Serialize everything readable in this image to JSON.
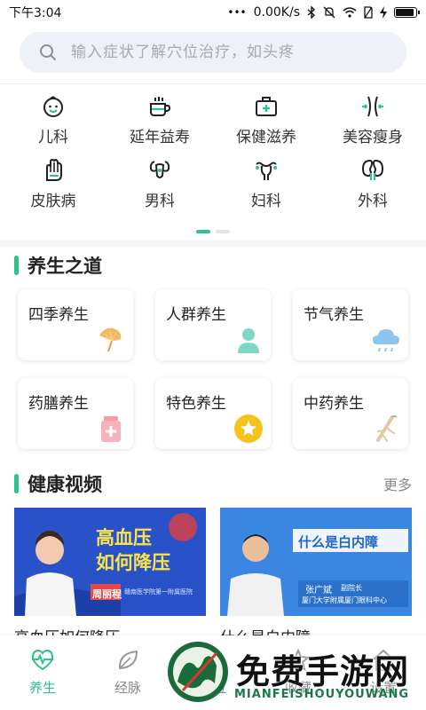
{
  "status_bar": {
    "time": "下午3:04",
    "dots": "•••",
    "speed": "0.00K/s",
    "battery_level": 0.95
  },
  "search": {
    "placeholder": "输入症状了解穴位治疗，如头疼"
  },
  "categories": [
    {
      "label": "儿科",
      "icon": "baby-face-icon"
    },
    {
      "label": "延年益寿",
      "icon": "tea-cup-icon"
    },
    {
      "label": "保健滋养",
      "icon": "medical-kit-icon"
    },
    {
      "label": "美容瘦身",
      "icon": "waist-slim-icon"
    },
    {
      "label": "皮肤病",
      "icon": "hand-skin-icon"
    },
    {
      "label": "男科",
      "icon": "male-organ-icon"
    },
    {
      "label": "妇科",
      "icon": "uterus-icon"
    },
    {
      "label": "外科",
      "icon": "kidney-icon"
    }
  ],
  "pager": {
    "pages": 2,
    "active": 0
  },
  "wellness_section": {
    "title": "养生之道",
    "cards": [
      {
        "label": "四季养生",
        "icon": "ginkgo-leaf-icon"
      },
      {
        "label": "人群养生",
        "icon": "person-icon"
      },
      {
        "label": "节气养生",
        "icon": "rain-cloud-icon"
      },
      {
        "label": "药膳养生",
        "icon": "medicine-bottle-icon"
      },
      {
        "label": "特色养生",
        "icon": "star-badge-icon"
      },
      {
        "label": "中药养生",
        "icon": "ginseng-root-icon"
      }
    ]
  },
  "video_section": {
    "title": "健康视频",
    "more": "更多",
    "videos": [
      {
        "title": "高血压如何降压",
        "thumb_line1": "高血压",
        "thumb_line2": "如何降压",
        "doctor": "周丽程",
        "hospital": "赣南医学院第一附属医院"
      },
      {
        "title": "什么是白内障",
        "thumb_banner": "什么是白内障",
        "doctor": "张广斌",
        "doctor_title": "副院长",
        "hospital": "厦门大学附属厦门眼科中心"
      }
    ]
  },
  "tabbar": {
    "tabs": [
      {
        "label": "养生",
        "icon": "heartbeat-icon",
        "active": true
      },
      {
        "label": "经脉",
        "icon": "leaf-icon",
        "active": false
      },
      {
        "label": "穴位",
        "icon": "acupoint-icon",
        "active": false
      },
      {
        "label": "收藏",
        "icon": "star-icon",
        "active": false
      },
      {
        "label": "设置",
        "icon": "home-icon",
        "active": false
      }
    ]
  },
  "watermark": {
    "text": "免费手游网",
    "sub": "MIANFEISHOUYOUWANG"
  },
  "colors": {
    "accent": "#2dc38a",
    "search_bg": "#eef1f8",
    "thumb_a": "#2a52c8",
    "thumb_b": "#3b86e0"
  }
}
